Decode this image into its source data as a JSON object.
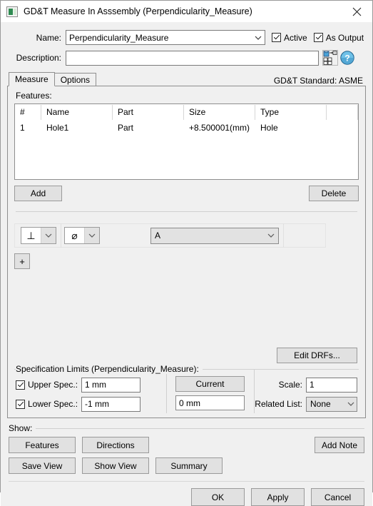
{
  "window": {
    "title": "GD&T Measure In Asssembly (Perpendicularity_Measure)",
    "icon": "app-icon",
    "close_label": "✕"
  },
  "form": {
    "name_label": "Name:",
    "name_value": "Perpendicularity_Measure",
    "description_label": "Description:",
    "description_value": "",
    "active_label": "Active",
    "active_checked": true,
    "as_output_label": "As Output",
    "as_output_checked": true,
    "datum_icon": "datum-reference-frame-icon",
    "help_icon": "help-icon"
  },
  "tabs": {
    "items": [
      {
        "label": "Measure",
        "active": true
      },
      {
        "label": "Options",
        "active": false
      }
    ],
    "standard_text": "GD&T Standard: ASME"
  },
  "features": {
    "label": "Features:",
    "columns": [
      "#",
      "Name",
      "Part",
      "Size",
      "Type",
      ""
    ],
    "rows": [
      {
        "num": "1",
        "name": "Hole1",
        "part": "Part",
        "size": "+8.500001(mm)",
        "type": "Hole",
        "extra": ""
      }
    ],
    "add_label": "Add",
    "delete_label": "Delete"
  },
  "fcf": {
    "symbol": "⊥",
    "symbol_name": "perpendicularity-symbol",
    "modifier": "⌀",
    "modifier_name": "diameter-symbol",
    "datum_value": "A",
    "add_row_label": "+",
    "edit_drfs_label": "Edit DRFs..."
  },
  "spec": {
    "group_title": "Specification Limits (Perpendicularity_Measure):",
    "upper_label": "Upper Spec.:",
    "upper_checked": true,
    "upper_value": "1 mm",
    "lower_label": "Lower Spec.:",
    "lower_checked": true,
    "lower_value": "-1 mm",
    "current_label": "Current",
    "current_value": "0 mm",
    "scale_label": "Scale:",
    "scale_value": "1",
    "related_list_label": "Related List:",
    "related_list_value": "None"
  },
  "show": {
    "title": "Show:",
    "features_label": "Features",
    "directions_label": "Directions",
    "add_note_label": "Add Note",
    "save_view_label": "Save View",
    "show_view_label": "Show View",
    "summary_label": "Summary"
  },
  "footer": {
    "ok_label": "OK",
    "apply_label": "Apply",
    "cancel_label": "Cancel"
  }
}
